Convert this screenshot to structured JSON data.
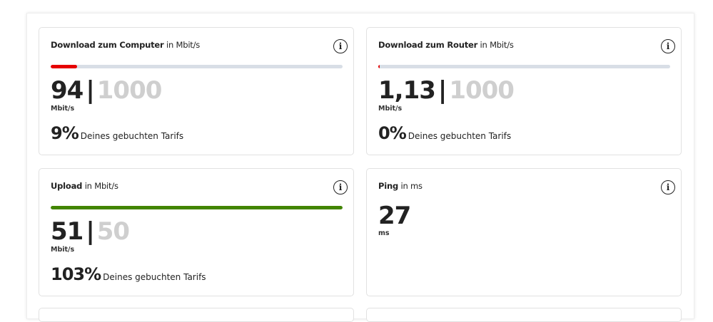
{
  "colors": {
    "accent_red": "#e60000",
    "accent_green": "#428500",
    "track": "#d8dee6",
    "max_value": "#cfcfcf"
  },
  "cards": {
    "download_computer": {
      "title_strong": "Download zum Computer",
      "title_rest": "in Mbit/s",
      "value": "94",
      "separator": "|",
      "max": "1000",
      "unit": "Mbit/s",
      "percent": "9%",
      "percent_text": "Deines gebuchten Tarifs",
      "progress": 0.09,
      "bar_color": "#e60000",
      "info_icon": "info-icon"
    },
    "download_router": {
      "title_strong": "Download zum Router",
      "title_rest": "in Mbit/s",
      "value": "1,13",
      "separator": "|",
      "max": "1000",
      "unit": "Mbit/s",
      "percent": "0%",
      "percent_text": "Deines gebuchten Tarifs",
      "progress": 0.001,
      "bar_color": "#e60000",
      "info_icon": "info-icon"
    },
    "upload": {
      "title_strong": "Upload",
      "title_rest": "in Mbit/s",
      "value": "51",
      "separator": "|",
      "max": "50",
      "unit": "Mbit/s",
      "percent": "103%",
      "percent_text": "Deines gebuchten Tarifs",
      "progress": 1.0,
      "bar_color": "#428500",
      "info_icon": "info-icon"
    },
    "ping": {
      "title_strong": "Ping",
      "title_rest": "in ms",
      "value": "27",
      "unit": "ms",
      "info_icon": "info-icon"
    }
  }
}
